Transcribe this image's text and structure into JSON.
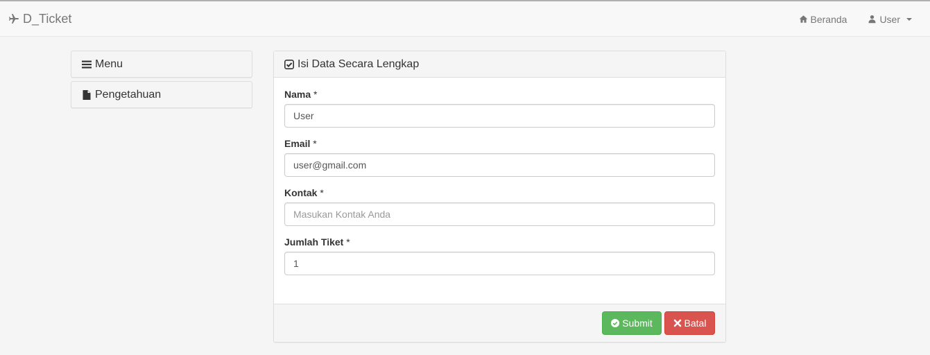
{
  "navbar": {
    "brand": "D_Ticket",
    "brand_icon": "plane-icon",
    "links": [
      {
        "label": "Beranda",
        "icon": "home-icon"
      },
      {
        "label": "User",
        "icon": "user-icon"
      }
    ]
  },
  "sidebar": {
    "items": [
      {
        "label": "Menu",
        "icon": "bars-icon"
      },
      {
        "label": "Pengetahuan",
        "icon": "file-icon"
      }
    ]
  },
  "form": {
    "heading": "Isi Data Secara Lengkap",
    "heading_icon": "check-square-icon",
    "fields": [
      {
        "label": "Nama",
        "required": "*",
        "value": "User",
        "placeholder": ""
      },
      {
        "label": "Email",
        "required": "*",
        "value": "user@gmail.com",
        "placeholder": ""
      },
      {
        "label": "Kontak",
        "required": "*",
        "value": "",
        "placeholder": "Masukan Kontak Anda"
      },
      {
        "label": "Jumlah Tiket",
        "required": "*",
        "value": "1",
        "placeholder": ""
      }
    ],
    "submit_label": "Submit",
    "cancel_label": "Batal"
  },
  "colors": {
    "success": "#5cb85c",
    "danger": "#d9534f",
    "nav_text": "#777777"
  }
}
